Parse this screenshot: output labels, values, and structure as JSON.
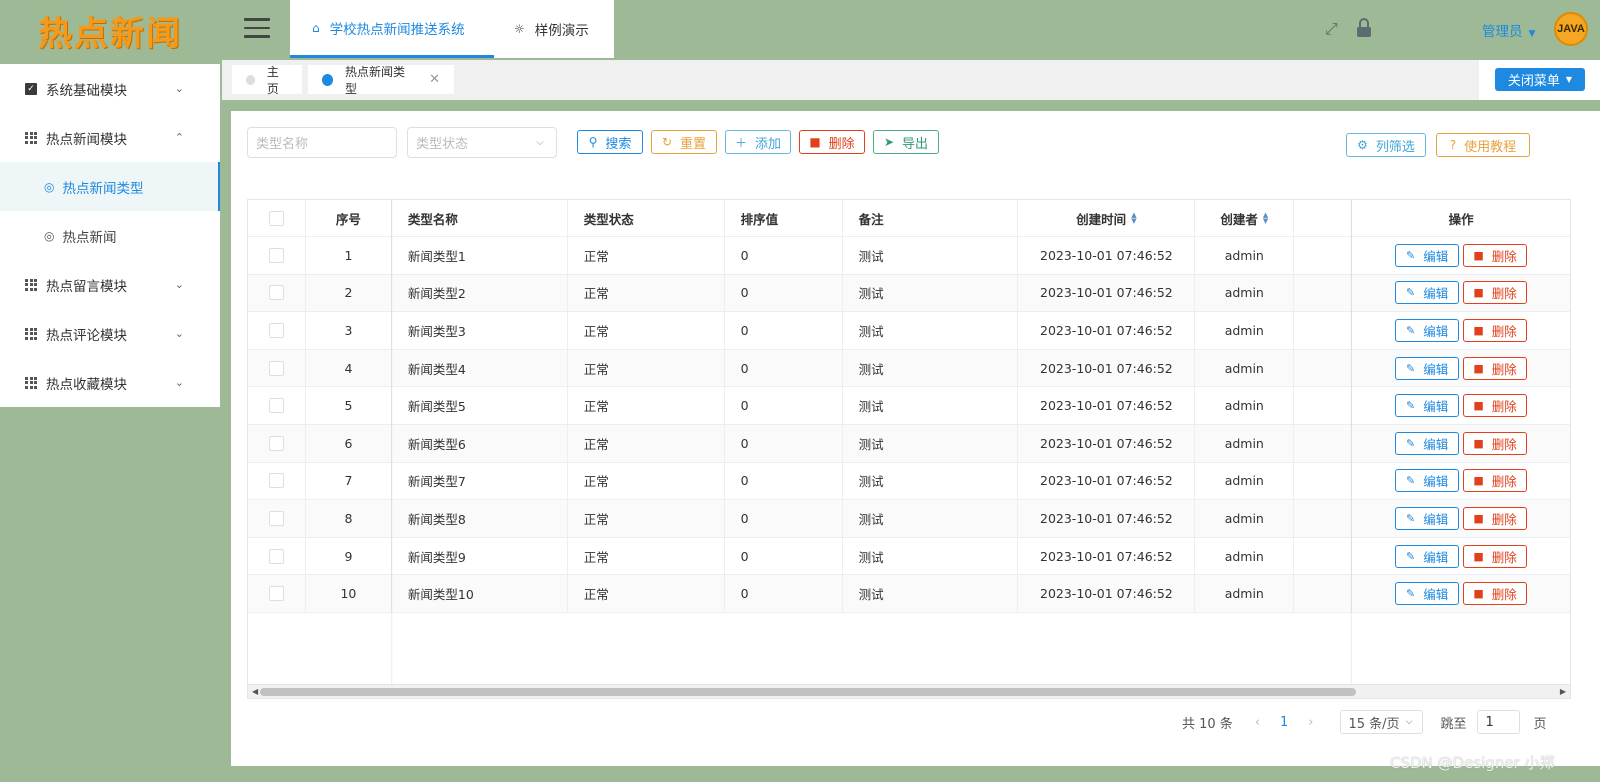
{
  "logo": {
    "text": "热点新闻"
  },
  "sidebar": {
    "items": [
      {
        "label": "系统基础模块",
        "icon": "checkbox-icon",
        "expanded": false
      },
      {
        "label": "热点新闻模块",
        "icon": "grid-icon",
        "expanded": true,
        "children": [
          {
            "label": "热点新闻类型",
            "active": true
          },
          {
            "label": "热点新闻",
            "active": false
          }
        ]
      },
      {
        "label": "热点留言模块",
        "icon": "grid-icon",
        "expanded": false
      },
      {
        "label": "热点评论模块",
        "icon": "grid-icon",
        "expanded": false
      },
      {
        "label": "热点收藏模块",
        "icon": "grid-icon",
        "expanded": false
      }
    ]
  },
  "header": {
    "tabs": [
      {
        "label": "学校热点新闻推送系统",
        "icon": "home-icon",
        "active": true
      },
      {
        "label": "样例演示",
        "icon": "lightbulb-icon",
        "active": false
      }
    ],
    "user_label": "管理员",
    "avatar_text": "JAVA"
  },
  "tagbar": {
    "tags": [
      {
        "label": "主页",
        "active": false
      },
      {
        "label": "热点新闻类型",
        "active": true
      }
    ],
    "close_menu_label": "关闭菜单"
  },
  "toolbar": {
    "name_placeholder": "类型名称",
    "status_placeholder": "类型状态",
    "search_label": "搜索",
    "reset_label": "重置",
    "add_label": "添加",
    "delete_label": "删除",
    "export_label": "导出",
    "column_filter_label": "列筛选",
    "tutorial_label": "使用教程"
  },
  "table": {
    "columns": [
      "序号",
      "类型名称",
      "类型状态",
      "排序值",
      "备注",
      "创建时间",
      "创建者",
      "操作"
    ],
    "edit_label": "编辑",
    "delete_label": "删除",
    "rows": [
      {
        "idx": "1",
        "name": "新闻类型1",
        "status": "正常",
        "sort": "0",
        "note": "测试",
        "time": "2023-10-01 07:46:52",
        "user": "admin"
      },
      {
        "idx": "2",
        "name": "新闻类型2",
        "status": "正常",
        "sort": "0",
        "note": "测试",
        "time": "2023-10-01 07:46:52",
        "user": "admin"
      },
      {
        "idx": "3",
        "name": "新闻类型3",
        "status": "正常",
        "sort": "0",
        "note": "测试",
        "time": "2023-10-01 07:46:52",
        "user": "admin"
      },
      {
        "idx": "4",
        "name": "新闻类型4",
        "status": "正常",
        "sort": "0",
        "note": "测试",
        "time": "2023-10-01 07:46:52",
        "user": "admin"
      },
      {
        "idx": "5",
        "name": "新闻类型5",
        "status": "正常",
        "sort": "0",
        "note": "测试",
        "time": "2023-10-01 07:46:52",
        "user": "admin"
      },
      {
        "idx": "6",
        "name": "新闻类型6",
        "status": "正常",
        "sort": "0",
        "note": "测试",
        "time": "2023-10-01 07:46:52",
        "user": "admin"
      },
      {
        "idx": "7",
        "name": "新闻类型7",
        "status": "正常",
        "sort": "0",
        "note": "测试",
        "time": "2023-10-01 07:46:52",
        "user": "admin"
      },
      {
        "idx": "8",
        "name": "新闻类型8",
        "status": "正常",
        "sort": "0",
        "note": "测试",
        "time": "2023-10-01 07:46:52",
        "user": "admin"
      },
      {
        "idx": "9",
        "name": "新闻类型9",
        "status": "正常",
        "sort": "0",
        "note": "测试",
        "time": "2023-10-01 07:46:52",
        "user": "admin"
      },
      {
        "idx": "10",
        "name": "新闻类型10",
        "status": "正常",
        "sort": "0",
        "note": "测试",
        "time": "2023-10-01 07:46:52",
        "user": "admin"
      }
    ]
  },
  "pagination": {
    "total_label": "共 10 条",
    "current_page": "1",
    "page_size_label": "15 条/页",
    "jump_label": "跳至",
    "jump_value": "1",
    "page_suffix": "页"
  },
  "watermark": "CSDN @Designer 小郑",
  "colors": {
    "accent": "#1e89e0",
    "background": "#9db996",
    "danger": "#e0401b",
    "warning": "#e6a23c",
    "logo": "#f59a18"
  }
}
